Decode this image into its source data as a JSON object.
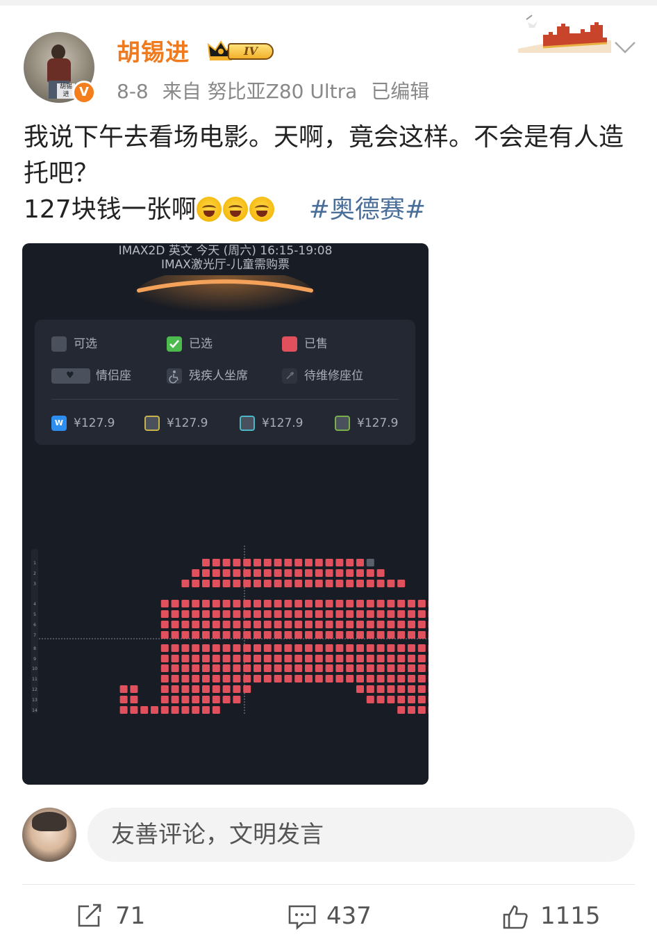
{
  "post": {
    "username": "胡锡进",
    "vip_level": "IV",
    "verified_mark": "V",
    "avatar_caption": "胡锡进",
    "date": "8-8",
    "source_prefix": "来自",
    "device": "努比亚Z80 Ultra",
    "edited": "已编辑",
    "text_line1": "我说下午去看场电影。天啊，竟会这样。不会是有人造托吧？",
    "text_line2": "127块钱一张啊",
    "emoji": "laughing-crying-emoji",
    "hashtag": "#奥德赛#"
  },
  "cinema": {
    "info_line1": "IMAX2D 英文 今天 (周六) 16:15-19:08",
    "info_line2": "IMAX激光厅-儿童需购票",
    "legend": {
      "available": "可选",
      "selected": "已选",
      "sold": "已售",
      "couple": "情侣座",
      "accessible": "残疾人坐席",
      "maintenance": "待维修座位",
      "prices": [
        "¥127.9",
        "¥127.9",
        "¥127.9",
        "¥127.9"
      ],
      "price_colors": [
        "#2d8ef0",
        "#c8b44a",
        "#4ab8c8",
        "#7ab04a"
      ]
    },
    "row_labels": [
      "1",
      "2",
      "3",
      "4",
      "5",
      "6",
      "7",
      "8",
      "9",
      "10",
      "11",
      "12",
      "13",
      "14"
    ],
    "colors": {
      "sold": "#e0505d",
      "available": "#5a606c",
      "selected": "#4cba4c",
      "background": "#181c24"
    }
  },
  "comment": {
    "placeholder": "友善评论，文明发言"
  },
  "actions": {
    "repost_count": "71",
    "comment_count": "437",
    "like_count": "1115"
  }
}
